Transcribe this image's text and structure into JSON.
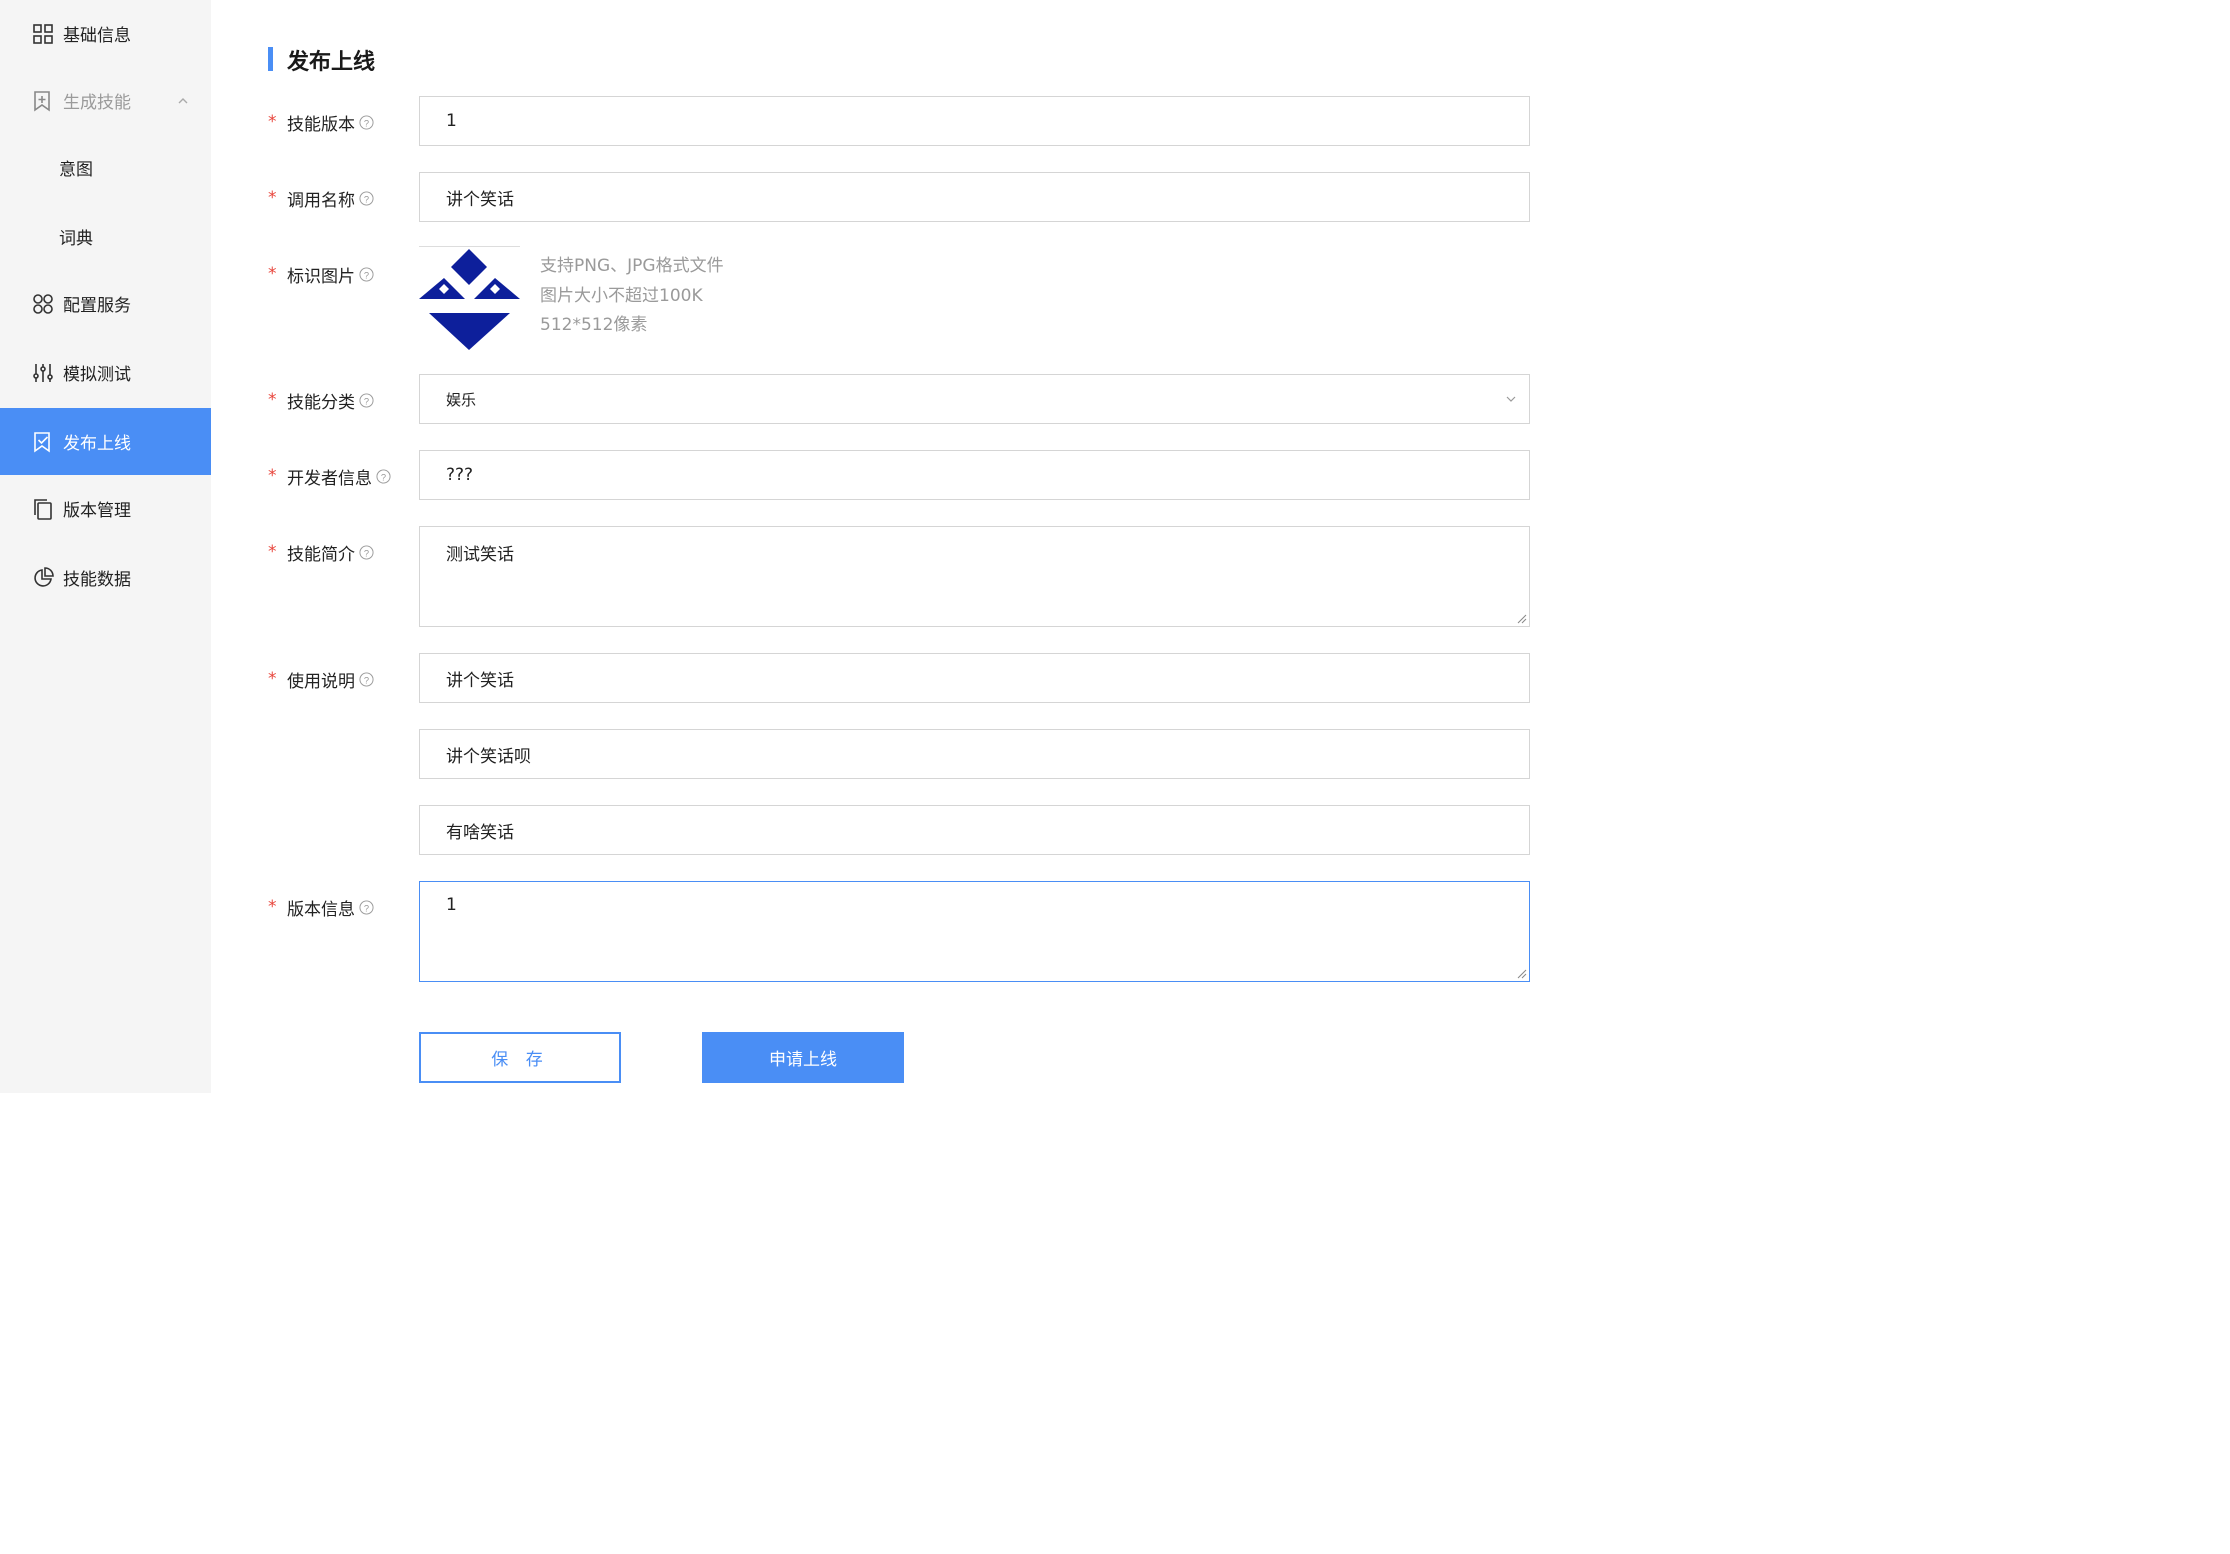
{
  "sidebar": {
    "items": [
      {
        "label": "基础信息",
        "icon": "grid-icon"
      },
      {
        "label": "生成技能",
        "icon": "bookmark-plus-icon"
      },
      {
        "label": "意图"
      },
      {
        "label": "词典"
      },
      {
        "label": "配置服务",
        "icon": "apps-icon"
      },
      {
        "label": "模拟测试",
        "icon": "sliders-icon"
      },
      {
        "label": "发布上线",
        "icon": "bookmark-check-icon",
        "active": true
      },
      {
        "label": "版本管理",
        "icon": "copy-icon"
      },
      {
        "label": "技能数据",
        "icon": "pie-chart-icon"
      }
    ]
  },
  "main": {
    "section_title": "发布上线",
    "fields": {
      "version": {
        "label": "技能版本",
        "value": "1"
      },
      "invoke_name": {
        "label": "调用名称",
        "value": "讲个笑话"
      },
      "logo": {
        "label": "标识图片",
        "hints": [
          "支持PNG、JPG格式文件",
          "图片大小不超过100K",
          "512*512像素"
        ]
      },
      "category": {
        "label": "技能分类",
        "value": "娱乐"
      },
      "developer": {
        "label": "开发者信息",
        "value": "???"
      },
      "intro": {
        "label": "技能简介",
        "value": "测试笑话"
      },
      "usage": {
        "label": "使用说明",
        "values": [
          "讲个笑话",
          "讲个笑话呗",
          "有啥笑话"
        ]
      },
      "version_info": {
        "label": "版本信息",
        "value": "1"
      }
    },
    "required_mark": "*",
    "buttons": {
      "save": "保 存",
      "submit": "申请上线"
    }
  },
  "colors": {
    "accent": "#4a8ef5",
    "required": "#e8453c",
    "logo": "#0d1f9b"
  }
}
